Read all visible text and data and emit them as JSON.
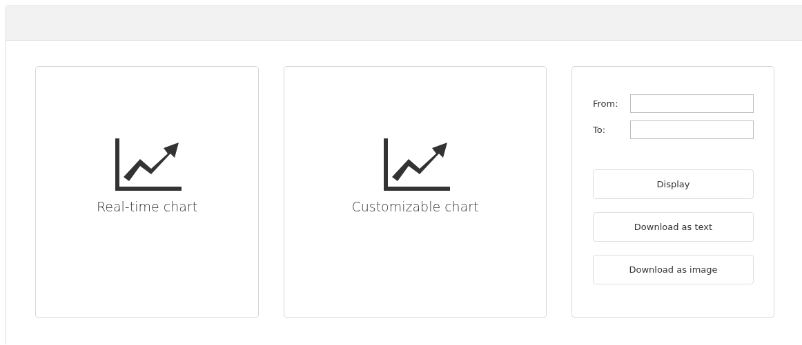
{
  "charts": [
    {
      "label": "Real-time chart"
    },
    {
      "label": "Customizable chart"
    }
  ],
  "range": {
    "fields": [
      {
        "label": "From:"
      },
      {
        "label": "To:"
      }
    ],
    "buttons": [
      "Display",
      "Download as text",
      "Download as image"
    ]
  }
}
